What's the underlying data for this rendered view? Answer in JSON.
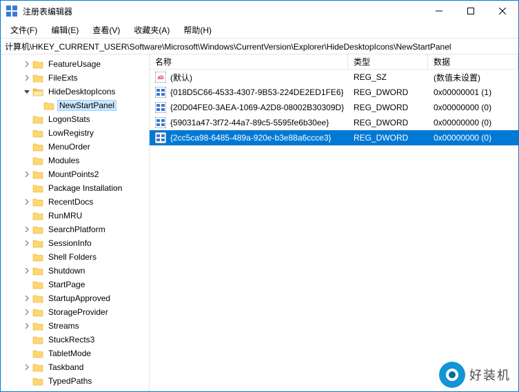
{
  "titlebar": {
    "title": "注册表编辑器"
  },
  "menu": {
    "file": "文件(F)",
    "edit": "编辑(E)",
    "view": "查看(V)",
    "favorites": "收藏夹(A)",
    "help": "帮助(H)"
  },
  "address": "计算机\\HKEY_CURRENT_USER\\Software\\Microsoft\\Windows\\CurrentVersion\\Explorer\\HideDesktopIcons\\NewStartPanel",
  "tree": {
    "items": [
      {
        "indent": 2,
        "exp": "closed",
        "label": "FeatureUsage"
      },
      {
        "indent": 2,
        "exp": "closed",
        "label": "FileExts"
      },
      {
        "indent": 2,
        "exp": "open",
        "label": "HideDesktopIcons",
        "open_folder": true
      },
      {
        "indent": 3,
        "exp": "none",
        "label": "NewStartPanel",
        "selected": true
      },
      {
        "indent": 2,
        "exp": "none",
        "label": "LogonStats"
      },
      {
        "indent": 2,
        "exp": "none",
        "label": "LowRegistry"
      },
      {
        "indent": 2,
        "exp": "none",
        "label": "MenuOrder"
      },
      {
        "indent": 2,
        "exp": "none",
        "label": "Modules"
      },
      {
        "indent": 2,
        "exp": "closed",
        "label": "MountPoints2"
      },
      {
        "indent": 2,
        "exp": "none",
        "label": "Package Installation"
      },
      {
        "indent": 2,
        "exp": "closed",
        "label": "RecentDocs"
      },
      {
        "indent": 2,
        "exp": "none",
        "label": "RunMRU"
      },
      {
        "indent": 2,
        "exp": "closed",
        "label": "SearchPlatform"
      },
      {
        "indent": 2,
        "exp": "closed",
        "label": "SessionInfo"
      },
      {
        "indent": 2,
        "exp": "none",
        "label": "Shell Folders"
      },
      {
        "indent": 2,
        "exp": "closed",
        "label": "Shutdown"
      },
      {
        "indent": 2,
        "exp": "none",
        "label": "StartPage"
      },
      {
        "indent": 2,
        "exp": "closed",
        "label": "StartupApproved"
      },
      {
        "indent": 2,
        "exp": "closed",
        "label": "StorageProvider"
      },
      {
        "indent": 2,
        "exp": "closed",
        "label": "Streams"
      },
      {
        "indent": 2,
        "exp": "none",
        "label": "StuckRects3"
      },
      {
        "indent": 2,
        "exp": "none",
        "label": "TabletMode"
      },
      {
        "indent": 2,
        "exp": "closed",
        "label": "Taskband"
      },
      {
        "indent": 2,
        "exp": "none",
        "label": "TypedPaths"
      }
    ]
  },
  "list": {
    "headers": {
      "name": "名称",
      "type": "类型",
      "data": "数据"
    },
    "rows": [
      {
        "icon": "sz",
        "name": "(默认)",
        "type": "REG_SZ",
        "data": "(数值未设置)"
      },
      {
        "icon": "dw",
        "name": "{018D5C66-4533-4307-9B53-224DE2ED1FE6}",
        "type": "REG_DWORD",
        "data": "0x00000001 (1)"
      },
      {
        "icon": "dw",
        "name": "{20D04FE0-3AEA-1069-A2D8-08002B30309D}",
        "type": "REG_DWORD",
        "data": "0x00000000 (0)"
      },
      {
        "icon": "dw",
        "name": "{59031a47-3f72-44a7-89c5-5595fe6b30ee}",
        "type": "REG_DWORD",
        "data": "0x00000000 (0)"
      },
      {
        "icon": "dw",
        "name": "{2cc5ca98-6485-489a-920e-b3e88a6ccce3}",
        "type": "REG_DWORD",
        "data": "0x00000000 (0)",
        "selected": true
      }
    ]
  },
  "watermark": {
    "text": "好装机"
  }
}
